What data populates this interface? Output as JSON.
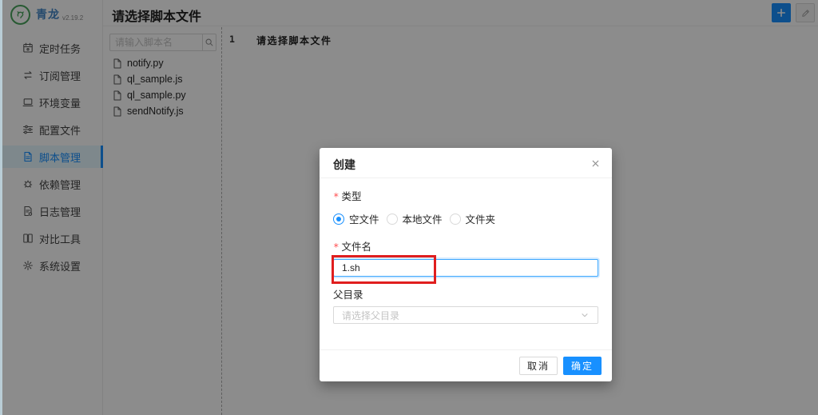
{
  "brand": {
    "name": "青龙",
    "version": "v2.19.2"
  },
  "page_title": "请选择脚本文件",
  "sidebar": {
    "items": [
      {
        "label": "定时任务",
        "icon": "calendar-icon",
        "active": false
      },
      {
        "label": "订阅管理",
        "icon": "subscription-icon",
        "active": false
      },
      {
        "label": "环境变量",
        "icon": "laptop-icon",
        "active": false
      },
      {
        "label": "配置文件",
        "icon": "sliders-icon",
        "active": false
      },
      {
        "label": "脚本管理",
        "icon": "file-text-icon",
        "active": true
      },
      {
        "label": "依赖管理",
        "icon": "dependency-icon",
        "active": false
      },
      {
        "label": "日志管理",
        "icon": "log-icon",
        "active": false
      },
      {
        "label": "对比工具",
        "icon": "diff-icon",
        "active": false
      },
      {
        "label": "系统设置",
        "icon": "gear-icon",
        "active": false
      }
    ]
  },
  "toolbar": {
    "icons": [
      "plus-icon",
      "edit-icon"
    ],
    "edit_disabled": true
  },
  "files": {
    "search_placeholder": "请输入脚本名",
    "items": [
      "notify.py",
      "ql_sample.js",
      "ql_sample.py",
      "sendNotify.js"
    ]
  },
  "editor": {
    "line_number": "1",
    "placeholder_text": "请选择脚本文件"
  },
  "modal": {
    "title": "创建",
    "required_mark": "*",
    "type_field": {
      "label": "类型",
      "required": true,
      "options": [
        {
          "label": "空文件",
          "selected": true
        },
        {
          "label": "本地文件",
          "selected": false
        },
        {
          "label": "文件夹",
          "selected": false
        }
      ]
    },
    "filename_field": {
      "label": "文件名",
      "required": true,
      "value": "1.sh"
    },
    "parent_field": {
      "label": "父目录",
      "required": false,
      "placeholder": "请选择父目录"
    },
    "footer": {
      "cancel_label": "取消",
      "ok_label": "确定"
    }
  },
  "annotation": {
    "type": "highlight-box",
    "target": "filename-input",
    "color": "#e01e1e"
  },
  "colors": {
    "accent": "#1890ff",
    "selected_menu_bg": "#e6f7ff",
    "annotation_red": "#e01e1e",
    "brand_blue": "#4285c7",
    "logo_green": "#4aa45e",
    "required_red": "#ff4d4f",
    "mask": "rgba(0,0,0,0.45)"
  }
}
